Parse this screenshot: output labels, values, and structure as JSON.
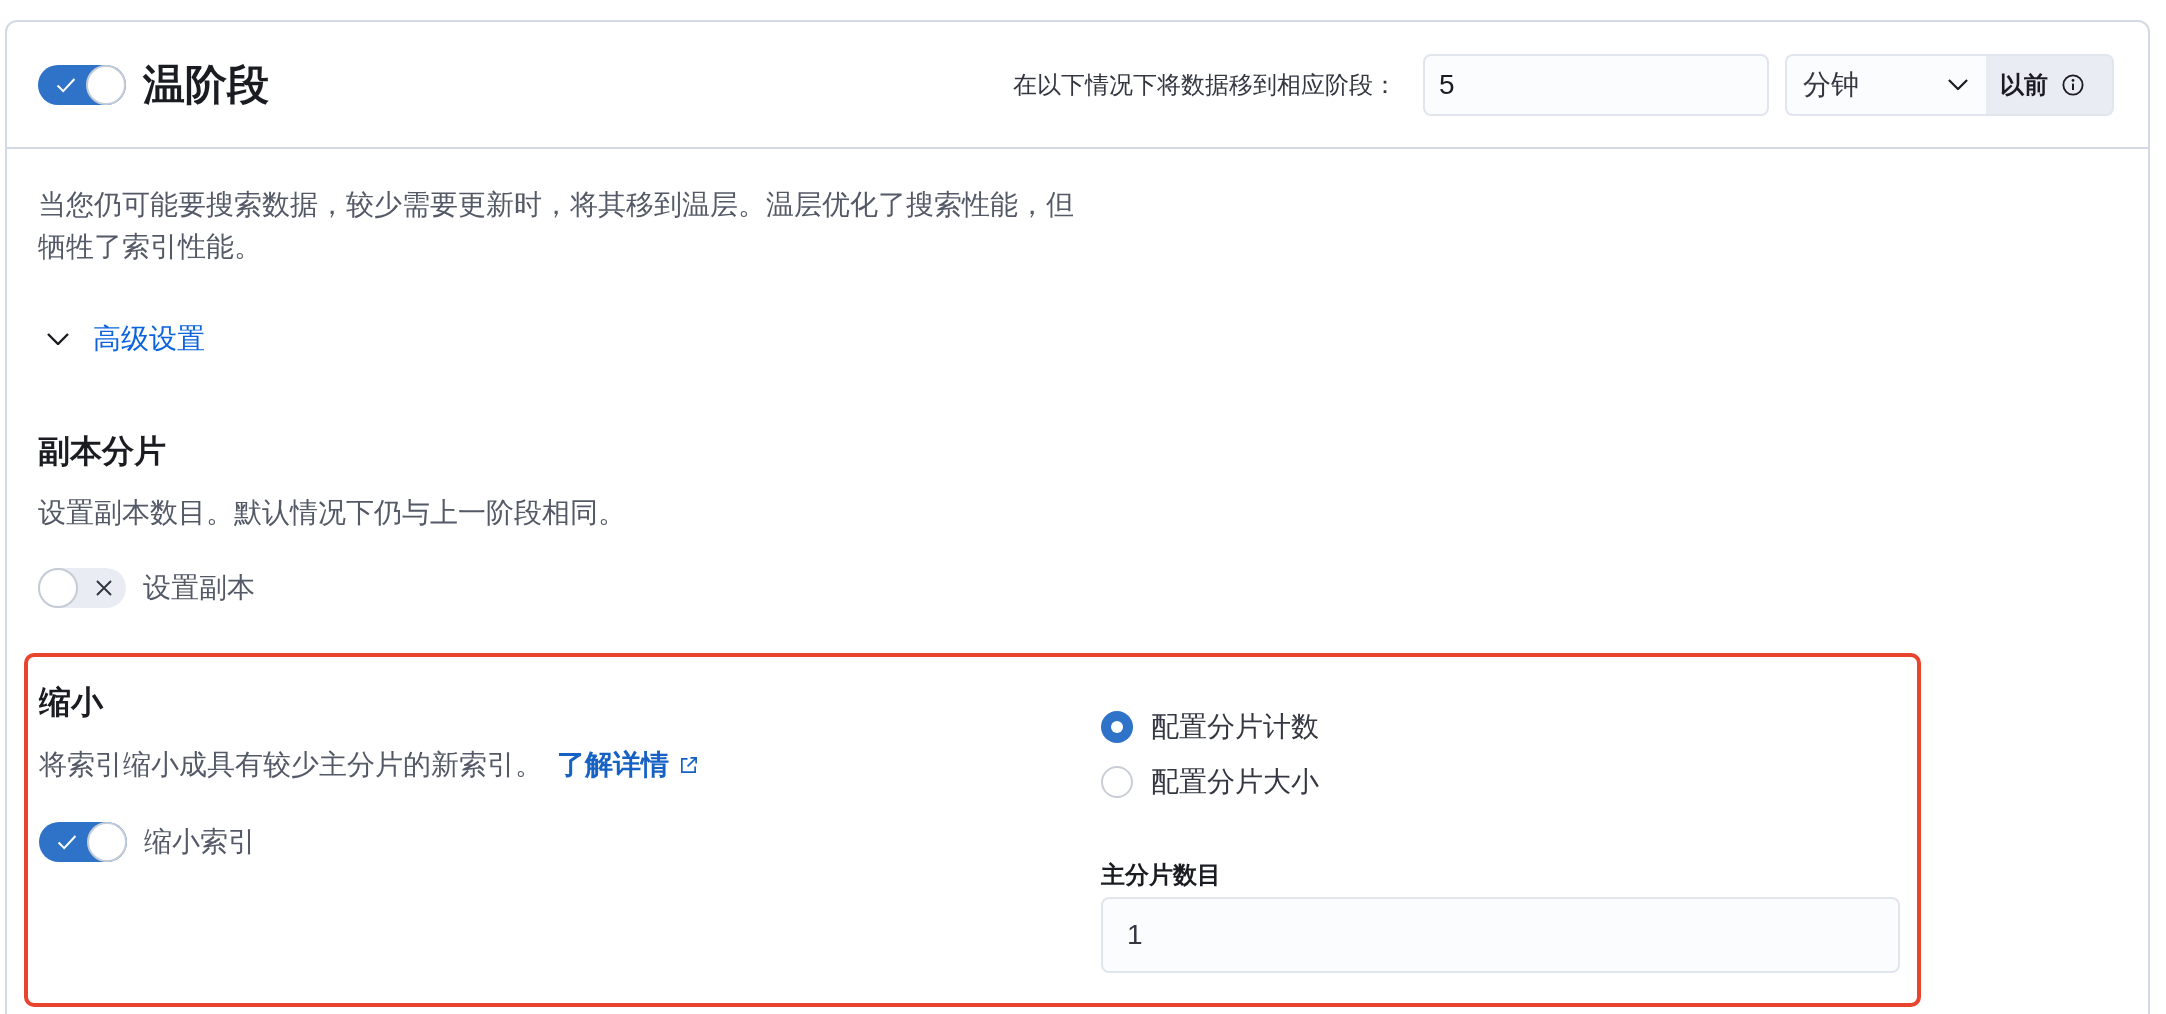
{
  "phase": {
    "enabled": true,
    "title": "温阶段",
    "timing": {
      "label": "在以下情况下将数据移到相应阶段：",
      "value": "5",
      "unit": "分钟",
      "suffix": "以前"
    }
  },
  "description": "当您仍可能要搜索数据，较少需要更新时，将其移到温层。温层优化了搜索性能，但牺牲了索引性能。",
  "advanced_settings": {
    "label": "高级设置",
    "expanded": true
  },
  "replicas": {
    "title": "副本分片",
    "description": "设置副本数目。默认情况下仍与上一阶段相同。",
    "toggle": {
      "label": "设置副本",
      "on": false
    }
  },
  "shrink": {
    "highlighted": true,
    "title": "缩小",
    "description": "将索引缩小成具有较少主分片的新索引。",
    "link": "了解详情",
    "toggle": {
      "label": "缩小索引",
      "on": true
    },
    "options": [
      {
        "label": "配置分片计数",
        "selected": true
      },
      {
        "label": "配置分片大小",
        "selected": false
      }
    ],
    "field": {
      "label": "主分片数目",
      "value": "1"
    }
  }
}
